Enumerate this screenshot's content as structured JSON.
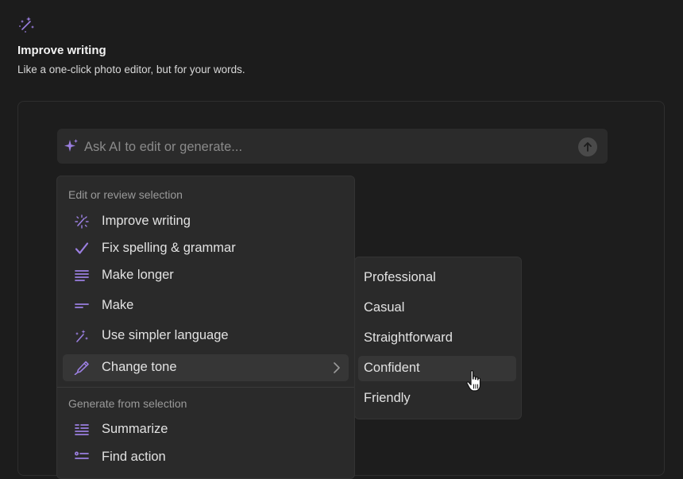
{
  "header": {
    "icon": "magic-wand-sparkle-icon",
    "title": "Improve writing",
    "subtitle": "Like a one-click photo editor, but for your words."
  },
  "ai_bar": {
    "icon": "sparkle-icon",
    "placeholder": "Ask AI to edit or generate...",
    "send_icon": "arrow-up-icon"
  },
  "menu": {
    "section1_label": "Edit or review selection",
    "items": [
      {
        "label": "Improve writing",
        "icon": "magic-wand-icon"
      },
      {
        "label": "Fix spelling & grammar",
        "icon": "check-icon"
      },
      {
        "label": "Make longer",
        "icon": "lines-long-icon"
      },
      {
        "label": "Make",
        "icon": "lines-short-icon"
      },
      {
        "label": "Use simpler language",
        "icon": "magic-wand-icon"
      },
      {
        "label": "Change tone",
        "icon": "pen-nib-icon",
        "active": true
      }
    ],
    "section2_label": "Generate from selection",
    "items2": [
      {
        "label": "Summarize",
        "icon": "summary-lines-icon"
      },
      {
        "label": "Find action",
        "icon": "checklist-icon"
      }
    ]
  },
  "submenu": {
    "items": [
      "Professional",
      "Casual",
      "Straightforward",
      "Confident",
      "Friendly"
    ],
    "hovered": "Confident"
  },
  "colors": {
    "background": "#1c1c1c",
    "menu_bg": "#2a2a2a",
    "accent": "#9b7fe0"
  }
}
